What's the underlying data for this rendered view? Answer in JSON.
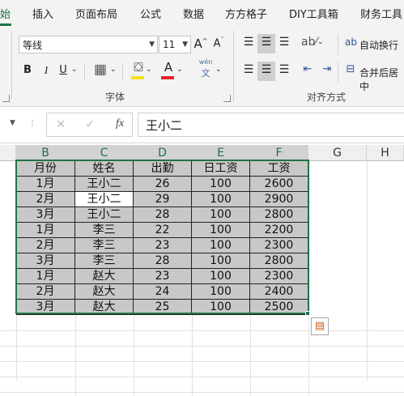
{
  "tabs": [
    {
      "label": "始",
      "active": true
    },
    {
      "label": "插入"
    },
    {
      "label": "页面布局"
    },
    {
      "label": "公式"
    },
    {
      "label": "数据"
    },
    {
      "label": "方方格子"
    },
    {
      "label": "DIY工具箱"
    },
    {
      "label": "财务工具"
    }
  ],
  "font_group": {
    "font_name": "等线",
    "font_size": "11",
    "grow_icon": "A^",
    "shrink_icon": "Aˇ",
    "bold": "B",
    "italic": "I",
    "underline": "U",
    "phonetic_label": "wén",
    "phonetic_char": "文",
    "fill_color": "#f5e21b",
    "font_color": "#e3242b",
    "label": "字体"
  },
  "align_group": {
    "wrap_label": "自动换行",
    "merge_label": "合并后居中",
    "label": "对齐方式"
  },
  "formula_bar": {
    "cancel": "✕",
    "confirm": "✓",
    "fx": "fx",
    "value": "王小二"
  },
  "sheet": {
    "columns": [
      "B",
      "C",
      "D",
      "E",
      "F",
      "G",
      "H"
    ],
    "header": [
      "月份",
      "姓名",
      "出勤",
      "日工资",
      "工资"
    ],
    "rows": [
      [
        "1月",
        "王小二",
        "26",
        "100",
        "2600"
      ],
      [
        "2月",
        "王小二",
        "29",
        "100",
        "2900"
      ],
      [
        "3月",
        "王小二",
        "28",
        "100",
        "2800"
      ],
      [
        "1月",
        "李三",
        "22",
        "100",
        "2200"
      ],
      [
        "2月",
        "李三",
        "23",
        "100",
        "2300"
      ],
      [
        "3月",
        "李三",
        "28",
        "100",
        "2800"
      ],
      [
        "1月",
        "赵大",
        "23",
        "100",
        "2300"
      ],
      [
        "2月",
        "赵大",
        "24",
        "100",
        "2400"
      ],
      [
        "3月",
        "赵大",
        "25",
        "100",
        "2500"
      ]
    ],
    "active_cell": "C4"
  }
}
